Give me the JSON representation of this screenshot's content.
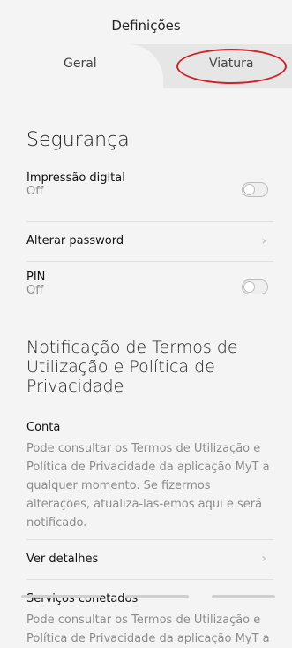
{
  "header": {
    "title": "Definições"
  },
  "tabs": [
    {
      "label": "Geral"
    },
    {
      "label": "Viatura"
    }
  ],
  "security": {
    "title": "Segurança",
    "fingerprint": {
      "label": "Impressão digital",
      "status": "Off"
    },
    "change_password": {
      "label": "Alterar password"
    },
    "pin": {
      "label": "PIN",
      "status": "Off"
    }
  },
  "terms": {
    "title": "Notificação de Termos de Utilização e Política de Privacidade",
    "account": {
      "heading": "Conta",
      "text": "Pode consultar os Termos de Utilização e Política de Privacidade da aplicação MyT a qualquer momento. Se fizermos alterações, atualiza-las-emos aqui e será notificado.",
      "details_label": "Ver detalhes"
    },
    "connected_services": {
      "heading": "Serviços conetados",
      "text": "Pode consultar os Termos de Utilização e Política de Privacidade da aplicação MyT a"
    }
  }
}
